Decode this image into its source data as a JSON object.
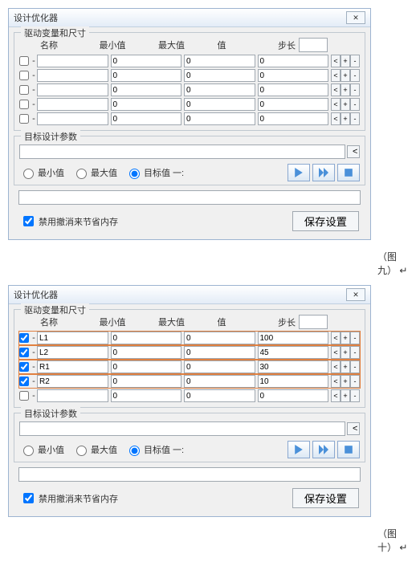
{
  "captions": {
    "fig9": "（图九）",
    "fig10": "（图十）",
    "ret": "↵"
  },
  "dialog": {
    "title": "设计优化器",
    "close_icon": "✕",
    "group1_title": "驱动变量和尺寸",
    "headers": {
      "name": "名称",
      "min": "最小值",
      "max": "最大值",
      "val": "值",
      "step": "步长"
    },
    "step_value": "",
    "btn_lt": "<",
    "btn_plus": "+",
    "btn_minus": "-",
    "group2_title": "目标设计参数",
    "browse": "<",
    "radio_min": "最小值",
    "radio_max": "最大值",
    "radio_target": "目标值 一:",
    "footer_check": "禁用撤消来节省内存",
    "save": "保存设置"
  },
  "panel1": {
    "rows": [
      {
        "c": false,
        "n": "",
        "mn": "0",
        "mx": "0",
        "v": "0"
      },
      {
        "c": false,
        "n": "",
        "mn": "0",
        "mx": "0",
        "v": "0"
      },
      {
        "c": false,
        "n": "",
        "mn": "0",
        "mx": "0",
        "v": "0"
      },
      {
        "c": false,
        "n": "",
        "mn": "0",
        "mx": "0",
        "v": "0"
      },
      {
        "c": false,
        "n": "",
        "mn": "0",
        "mx": "0",
        "v": "0"
      }
    ],
    "target": "",
    "radio_sel": 2,
    "footchk": true
  },
  "panel2": {
    "rows": [
      {
        "c": true,
        "n": "L1",
        "mn": "0",
        "mx": "0",
        "v": "100",
        "hl": true
      },
      {
        "c": true,
        "n": "L2",
        "mn": "0",
        "mx": "0",
        "v": "45",
        "hl": true
      },
      {
        "c": true,
        "n": "R1",
        "mn": "0",
        "mx": "0",
        "v": "30",
        "hl": true
      },
      {
        "c": true,
        "n": "R2",
        "mn": "0",
        "mx": "0",
        "v": "10",
        "hl": true
      },
      {
        "c": false,
        "n": "",
        "mn": "0",
        "mx": "0",
        "v": "0"
      }
    ],
    "target": "",
    "radio_sel": 2,
    "footchk": true
  }
}
